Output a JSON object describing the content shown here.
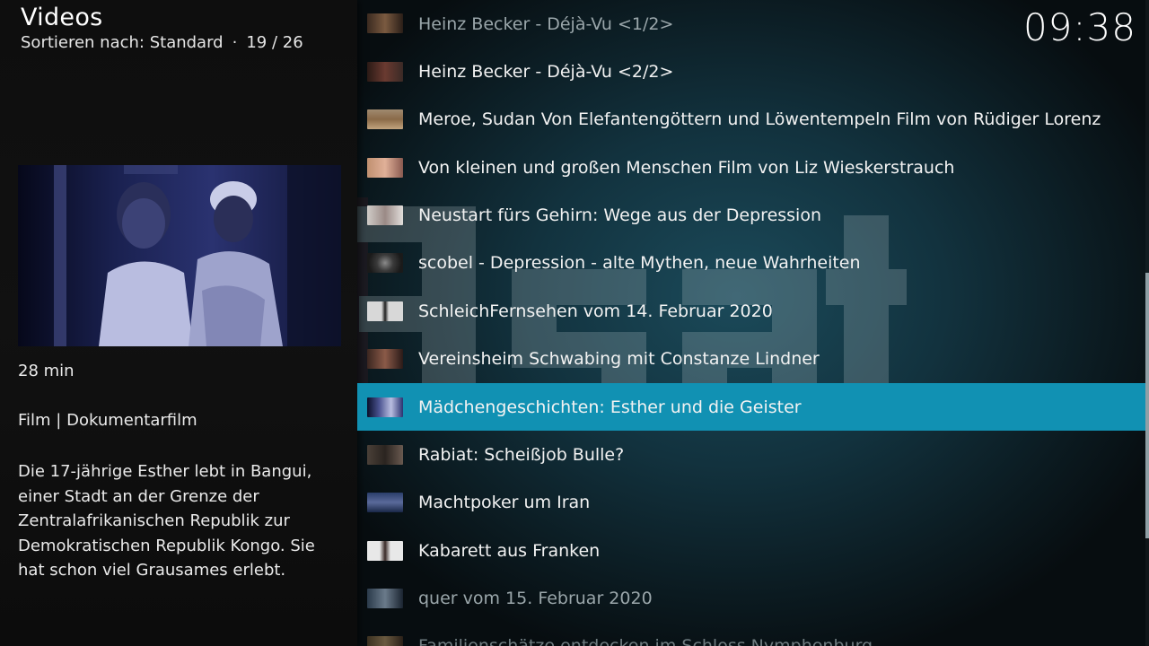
{
  "header": {
    "title": "Videos",
    "sort_label": "Sortieren nach: Standard",
    "separator": "·",
    "position": "19 / 26"
  },
  "clock": "09:38",
  "info": {
    "duration": "28 min",
    "genre": "Film | Dokumentarfilm",
    "plot": "Die 17-jährige Esther lebt in Bangui, einer Stadt an der Grenze der Zentralafrikanischen Republik zur Demokratischen Republik Kongo. Sie hat schon viel Grausames erlebt."
  },
  "list": {
    "items": [
      {
        "label": "Heinz Becker - Déjà-Vu <1/2>",
        "state": "dim"
      },
      {
        "label": "Heinz Becker - Déjà-Vu <2/2>",
        "state": "normal"
      },
      {
        "label": "Meroe, Sudan Von Elefantengöttern und Löwentempeln Film von Rüdiger Lorenz ...",
        "state": "normal"
      },
      {
        "label": "Von kleinen und großen Menschen Film von Liz Wieskerstrauch",
        "state": "normal"
      },
      {
        "label": "Neustart fürs Gehirn: Wege aus der Depression",
        "state": "normal"
      },
      {
        "label": "scobel - Depression - alte Mythen, neue Wahrheiten",
        "state": "normal"
      },
      {
        "label": "SchleichFernsehen vom 14. Februar 2020",
        "state": "normal"
      },
      {
        "label": "Vereinsheim Schwabing mit Constanze Lindner",
        "state": "normal"
      },
      {
        "label": "Mädchengeschichten: Esther und die Geister",
        "state": "focused"
      },
      {
        "label": "Rabiat: Scheißjob Bulle?",
        "state": "normal"
      },
      {
        "label": "Machtpoker um Iran",
        "state": "normal"
      },
      {
        "label": "Kabarett aus Franken",
        "state": "normal"
      },
      {
        "label": "quer vom 15. Februar 2020",
        "state": "dim"
      },
      {
        "label": "Familienschätze entdecken im Schloss Nymphenburg",
        "state": "faded"
      }
    ]
  },
  "colors": {
    "focus": "#1191b3",
    "panel": "#111111",
    "background": "#12323e"
  }
}
